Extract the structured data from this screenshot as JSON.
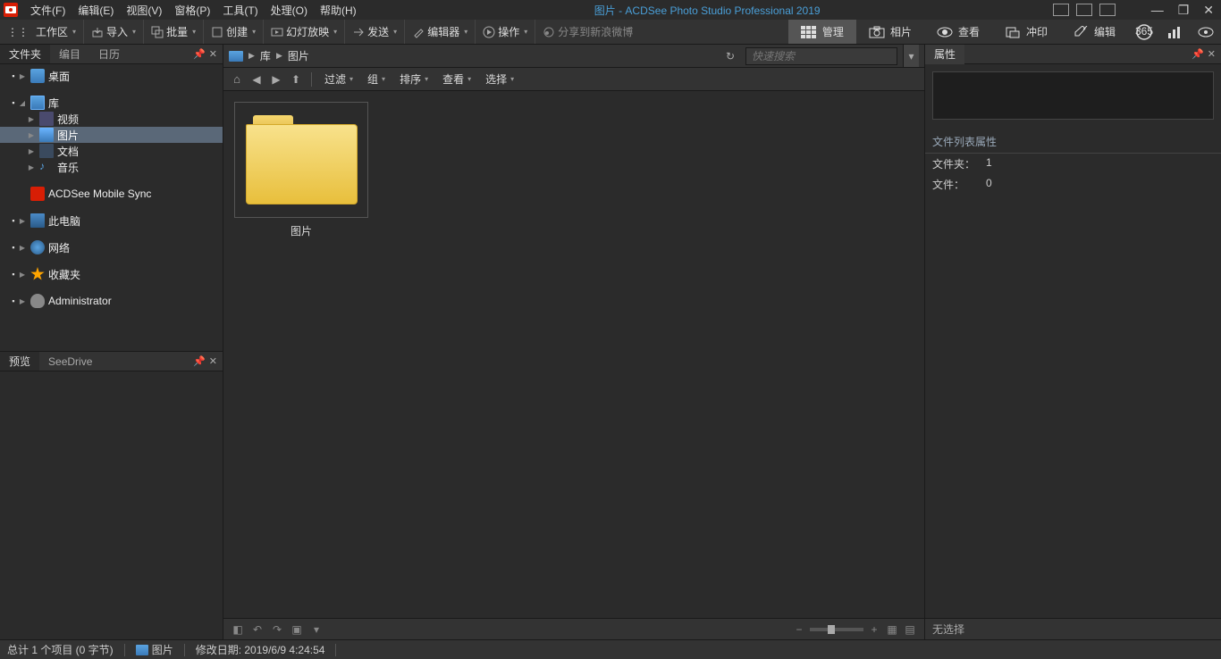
{
  "title": "图片 - ACDSee Photo Studio Professional 2019",
  "menus": [
    "文件(F)",
    "编辑(E)",
    "视图(V)",
    "窗格(P)",
    "工具(T)",
    "处理(O)",
    "帮助(H)"
  ],
  "toolbar": {
    "workspace": "工作区",
    "import": "导入",
    "batch": "批量",
    "create": "创建",
    "slideshow": "幻灯放映",
    "send": "发送",
    "editor": "编辑器",
    "action": "操作",
    "share": "分享到新浪微博"
  },
  "modes": {
    "manage": "管理",
    "photo": "相片",
    "view": "查看",
    "develop": "冲印",
    "edit": "编辑"
  },
  "left_tabs": {
    "folders": "文件夹",
    "catalog": "编目",
    "calendar": "日历"
  },
  "tree": {
    "desktop": "桌面",
    "library": "库",
    "video": "视频",
    "pictures": "图片",
    "documents": "文档",
    "music": "音乐",
    "sync": "ACDSee Mobile Sync",
    "thispc": "此电脑",
    "network": "网络",
    "favorites": "收藏夹",
    "admin": "Administrator"
  },
  "preview_tabs": {
    "preview": "预览",
    "seedrive": "SeeDrive"
  },
  "breadcrumb": {
    "lib": "库",
    "pics": "图片"
  },
  "search": {
    "placeholder": "快速搜索"
  },
  "filters": {
    "filter": "过滤",
    "group": "组",
    "sort": "排序",
    "view": "查看",
    "select": "选择"
  },
  "thumb": {
    "label": "图片"
  },
  "props": {
    "tab": "属性",
    "section": "文件列表属性",
    "folders_key": "文件夹：",
    "folders_val": "1",
    "files_key": "文件：",
    "files_val": "0",
    "nosel": "无选择"
  },
  "status": {
    "count": "总计 1 个项目 (0 字节)",
    "loc": "图片",
    "modified": "修改日期: 2019/6/9 4:24:54"
  }
}
